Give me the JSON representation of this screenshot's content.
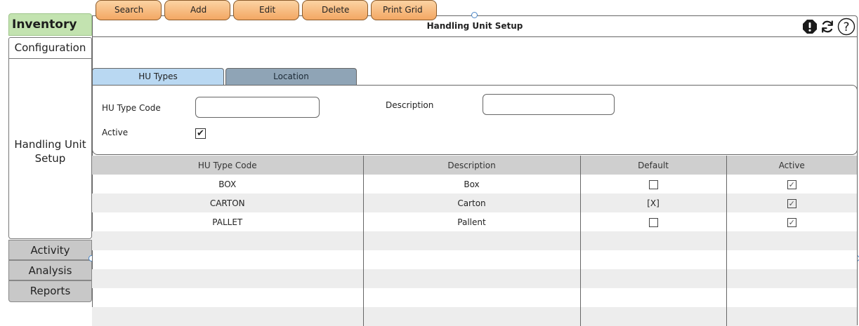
{
  "nav": {
    "app_title": "Inventory",
    "tabs": [
      "Configuration",
      "Handling Unit Setup",
      "Activity",
      "Analysis",
      "Reports"
    ]
  },
  "header": {
    "title": "Handling Unit Setup",
    "icons": [
      "alert-icon",
      "refresh-icon",
      "help-icon"
    ]
  },
  "toolbar": {
    "search": "Search",
    "add": "Add",
    "edit": "Edit",
    "delete": "Delete",
    "print_grid": "Print Grid"
  },
  "subtabs": {
    "hu_types": "HU Types",
    "location": "Location"
  },
  "form": {
    "hu_type_code_label": "HU Type Code",
    "hu_type_code_value": "",
    "description_label": "Description",
    "description_value": "",
    "active_label": "Active",
    "active_checked": true
  },
  "grid": {
    "columns": [
      "HU Type Code",
      "Description",
      "Default",
      "Active"
    ],
    "rows": [
      {
        "code": "BOX",
        "description": "Box",
        "default": false,
        "active": true
      },
      {
        "code": "CARTON",
        "description": "Carton",
        "default_text": "[X]",
        "active": true
      },
      {
        "code": "PALLET",
        "description": "Pallent",
        "default": false,
        "active": true
      }
    ]
  },
  "colors": {
    "app_title_bg": "#c3e3b0",
    "button_orange": "#f3a763",
    "tab_active": "#b9d8f2",
    "tab_inactive": "#8fa4b6",
    "grid_header": "#cfcfcf",
    "row_alt": "#ededed",
    "nav_gray": "#c8c8c8"
  }
}
